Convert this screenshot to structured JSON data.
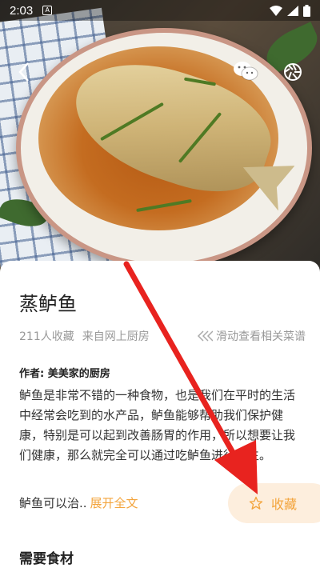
{
  "status_bar": {
    "time": "2:03",
    "notification_icon": "A"
  },
  "hero": {
    "back_icon": "back-arrow",
    "share_icon": "wechat",
    "camera_icon": "camera-shutter"
  },
  "recipe": {
    "title": "蒸鲈鱼",
    "favorites_count": "211人收藏",
    "source": "来自网上厨房",
    "swipe_hint": "滑动查看相关菜谱",
    "author_label": "作者:",
    "author_name": "美美家的厨房",
    "description": "鲈鱼是非常不错的一种食物，也是我们在平时的生活中经常会吃到的水产品，鲈鱼能够帮助我们保护健康，特别是可以起到改善肠胃的作用，所以想要让我们健康，那么就完全可以通过吃鲈鱼进行养生。",
    "description_tail": "鲈鱼可以治..",
    "expand_label": "展开全文",
    "favorite_button_label": "收藏",
    "ingredients_heading": "需要食材"
  },
  "colors": {
    "accent": "#f3a43c",
    "favorite_bg": "#fdeedd",
    "annotation_arrow": "#e8231f"
  }
}
